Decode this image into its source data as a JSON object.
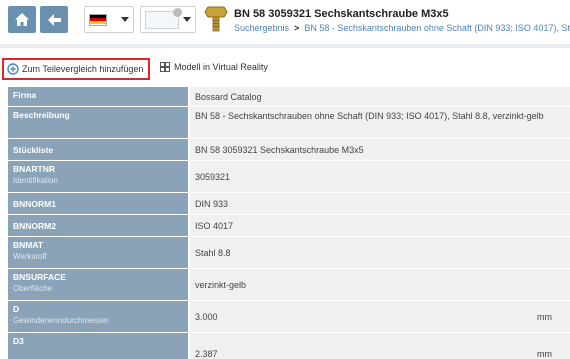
{
  "header": {
    "title": "BN 58 3059321 Sechskantschraube M3x5",
    "breadcrumb": {
      "root": "Suchergebnis",
      "separator": ">",
      "current": "BN 58 - Sechskantschrauben ohne Schaft (DIN 933; ISO 4017), Stahl 8.8, verzinkt-gelb"
    },
    "language_flag": "germany-flag",
    "colors": {
      "nav_button": "#6b8fae",
      "link": "#4a84bd",
      "highlight_border": "#d9272e",
      "label_cell": "#8aa3b8",
      "value_cell": "#eef0f2"
    }
  },
  "actions": {
    "compare_label": "Zum Teilevergleich hinzufügen",
    "vr_label": "Modell in Virtual Reality"
  },
  "properties": [
    {
      "key": "Firma",
      "sub": "",
      "value": "Bossard Catalog",
      "unit": ""
    },
    {
      "key": "Beschreibung",
      "sub": "",
      "value": "BN 58 - Sechskantschrauben ohne Schaft (DIN 933; ISO 4017), Stahl 8.8, verzinkt-gelb",
      "unit": ""
    },
    {
      "key": "Stückliste",
      "sub": "",
      "value": "BN 58 3059321 Sechskantschraube M3x5",
      "unit": ""
    },
    {
      "key": "BNARTNR",
      "sub": "Identifikation",
      "value": "3059321",
      "unit": ""
    },
    {
      "key": "BNNORM1",
      "sub": "",
      "value": "DIN 933",
      "unit": ""
    },
    {
      "key": "BNNORM2",
      "sub": "",
      "value": "ISO 4017",
      "unit": ""
    },
    {
      "key": "BNMAT",
      "sub": "Werkstoff",
      "value": "Stahl 8.8",
      "unit": ""
    },
    {
      "key": "BNSURFACE",
      "sub": "Oberfläche",
      "value": "verzinkt-gelb",
      "unit": ""
    },
    {
      "key": "D",
      "sub": "Gewindenenndurchmesser",
      "value": "3.000",
      "unit": "mm"
    },
    {
      "key": "D3",
      "sub": "",
      "value": "2.387",
      "unit": "mm"
    }
  ]
}
